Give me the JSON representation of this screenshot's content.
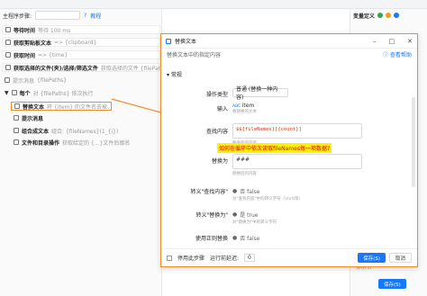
{
  "left": {
    "header": "主程序步骤:",
    "tutorial": "教程",
    "steps": [
      {
        "title": "等待时间",
        "desc": "等待 100 ms"
      },
      {
        "title": "获取剪贴板文本",
        "desc": "=> {clipboard}"
      },
      {
        "title": "获取时间",
        "desc": "=> {time}"
      },
      {
        "title": "获取选择的文件(夹)/选择/筛选文件",
        "desc": "获取选择的文件 {filePaths}"
      },
      {
        "title": "提示消息",
        "desc": "{filePaths}"
      },
      {
        "title": "每个",
        "desc": "对 {filePaths} 依次执行"
      },
      {
        "title": "替换文本",
        "desc": "将 {item} 的文件名去掉、取消路径"
      },
      {
        "title": "提示消息",
        "desc": ""
      },
      {
        "title": "组合成文本",
        "desc": "组合: {fileNames}(1_{i})"
      },
      {
        "title": "文件和目录操作",
        "desc": "获取给定的 {...}文件后缀名"
      }
    ]
  },
  "right": {
    "title": "变量定义",
    "footnote": "保存(S)"
  },
  "dialog": {
    "title": "替换文本",
    "subtitle": "替换文本中的指定内容",
    "help": "查看帮助",
    "section": "常规",
    "op_label": "操作类型",
    "op_value": "普通 (替换一种内容)",
    "input_label": "输入",
    "input_value": "item",
    "input_hint": "要替换的文本",
    "find_label": "查找内容",
    "find_value": "$${fileNames}[{count}]",
    "find_hint": "要查找的内容",
    "replace_label": "替换为",
    "replace_value": "###",
    "replace_hint": "替换后的内容",
    "escape_find_label": "转义\"查找内容\"",
    "escape_find_value": "否  false",
    "escape_find_hint": "对\"查找内容\"中的转义字符（\\n\\r\\t等）",
    "escape_replace_label": "转义\"替换为\"",
    "escape_replace_value": "是  true",
    "escape_replace_hint": "对\"替换为\"中的转义字符",
    "regex_label": "使用正则替换",
    "regex_value": "否  false",
    "footer_checkbox": "停用此步骤",
    "delay_label": "运行前延迟:",
    "delay_value": "0",
    "save": "保存(S)",
    "cancel": "取消"
  },
  "tip": "如何在循环中依次读取fileNames每一项数据?",
  "main_save": "保存(S)"
}
